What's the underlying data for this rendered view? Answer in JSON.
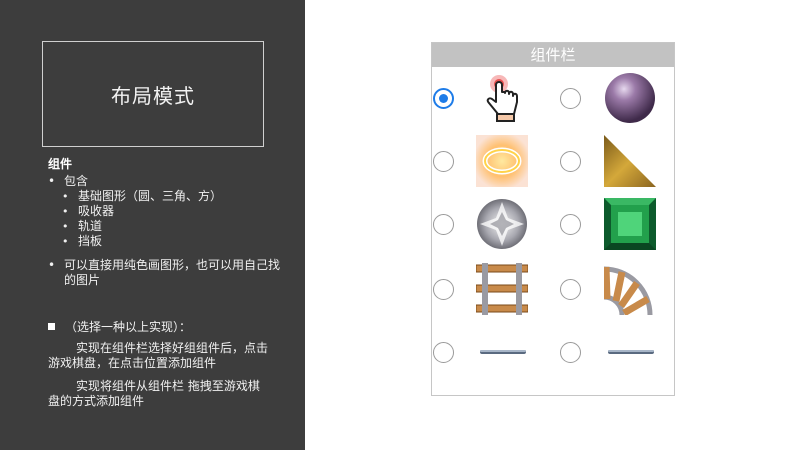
{
  "title": "布局模式",
  "components": {
    "heading": "组件",
    "include_label": "包含",
    "sub_items": [
      "基础图形（圆、三角、方）",
      "吸收器",
      "轨道",
      "挡板"
    ],
    "note": "可以直接用纯色画图形，也可以用自己找的图片"
  },
  "option_title": "（选择一种以上实现）：",
  "option1": "实现在组件栏选择好组组件后，点击游戏棋盘，在点击位置添加组件",
  "option2": "实现将组件从组件栏 拖拽至游戏棋盘的方式添加组件",
  "component_bar": {
    "header": "组件栏",
    "rows": [
      {
        "left": {
          "icon": "hand-pointer-icon",
          "selected": true
        },
        "right": {
          "icon": "purple-ball-icon",
          "selected": false
        }
      },
      {
        "left": {
          "icon": "glowing-ring-icon",
          "selected": false
        },
        "right": {
          "icon": "gold-triangle-icon",
          "selected": false
        }
      },
      {
        "left": {
          "icon": "diamond-circle-icon",
          "selected": false
        },
        "right": {
          "icon": "emerald-square-icon",
          "selected": false
        }
      },
      {
        "left": {
          "icon": "straight-track-icon",
          "selected": false
        },
        "right": {
          "icon": "curved-track-icon",
          "selected": false
        }
      },
      {
        "left": {
          "icon": "flipper-icon",
          "selected": false
        },
        "right": {
          "icon": "flipper-icon",
          "selected": false
        }
      }
    ]
  },
  "colors": {
    "left_panel_bg": "#3d3d3d",
    "radio_selected": "#1e7ce8",
    "bar_header_bg": "#c2c2c2"
  }
}
